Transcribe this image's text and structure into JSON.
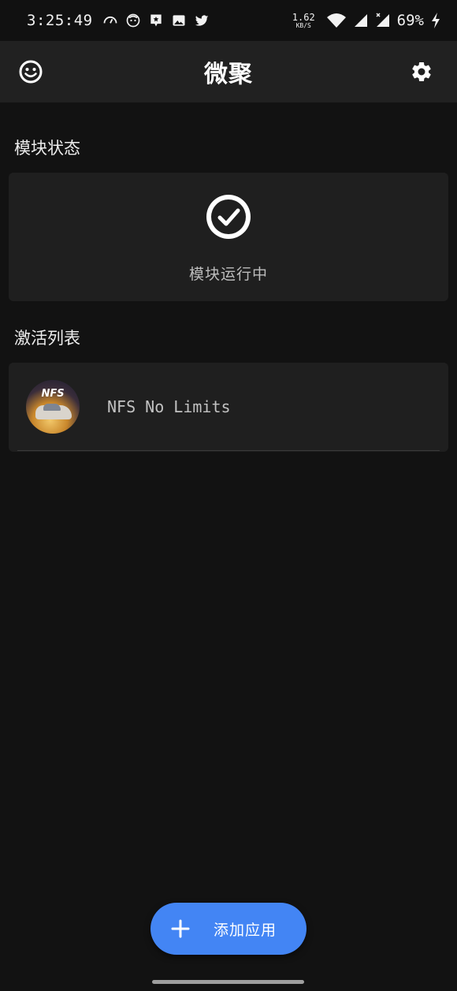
{
  "status_bar": {
    "time": "3:25:49",
    "net_speed_value": "1.62",
    "net_speed_unit": "KB/S",
    "battery_percent": "69%",
    "left_icons": [
      "speedometer-icon",
      "face-icon",
      "chat-star-icon",
      "image-icon",
      "twitter-icon"
    ],
    "right_icons": [
      "wifi-icon",
      "signal-icon",
      "signal-no-data-icon",
      "charging-bolt-icon"
    ]
  },
  "app_bar": {
    "title": "微聚",
    "left_icon": "smiley-icon",
    "right_icon": "gear-icon"
  },
  "module_status": {
    "section_title": "模块状态",
    "status_text": "模块运行中",
    "status_icon": "check-circle-icon"
  },
  "activation_list": {
    "section_title": "激活列表",
    "items": [
      {
        "name": "NFS No Limits",
        "icon_text": "NFS"
      }
    ]
  },
  "fab": {
    "label": "添加应用",
    "icon": "plus-icon",
    "color": "#4385f4"
  },
  "colors": {
    "background": "#121212",
    "app_bar": "#212121",
    "card": "#1f1f1f",
    "accent": "#4385f4"
  }
}
